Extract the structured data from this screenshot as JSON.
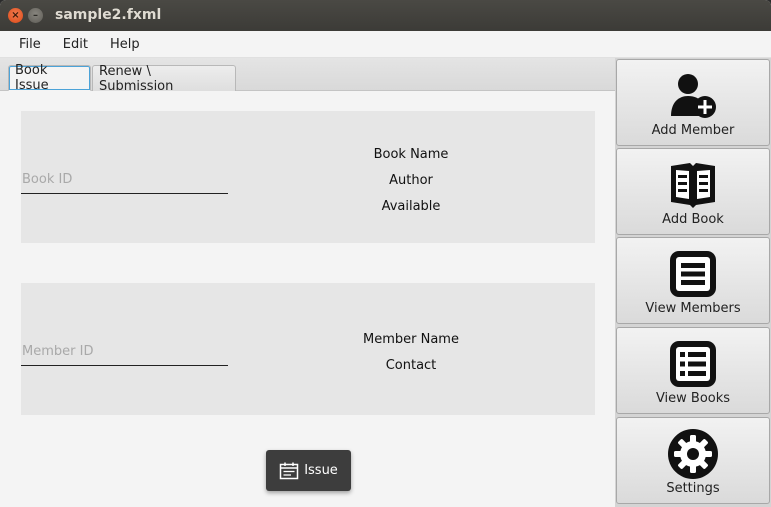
{
  "window": {
    "title": "sample2.fxml",
    "close_glyph": "×",
    "minimize_glyph": "–"
  },
  "menu": [
    "File",
    "Edit",
    "Help"
  ],
  "tabs": [
    {
      "label": "Book Issue",
      "active": true
    },
    {
      "label": "Renew \\ Submission",
      "active": false
    }
  ],
  "book_section": {
    "id_placeholder": "Book ID",
    "id_value": "",
    "info": [
      "Book Name",
      "Author",
      "Available"
    ]
  },
  "member_section": {
    "id_placeholder": "Member ID",
    "id_value": "",
    "info": [
      "Member Name",
      "Contact"
    ]
  },
  "issue_button": {
    "label": "Issue",
    "icon": "calendar-icon"
  },
  "sidebar": [
    {
      "label": "Add Member",
      "icon": "add-user-icon"
    },
    {
      "label": "Add Book",
      "icon": "open-book-icon"
    },
    {
      "label": "View Members",
      "icon": "list-icon"
    },
    {
      "label": "View Books",
      "icon": "grid-list-icon"
    },
    {
      "label": "Settings",
      "icon": "gear-icon"
    }
  ],
  "colors": {
    "titlebar": "#3c3b37",
    "close_button": "#de4a17",
    "tab_focus": "#4ca3d8",
    "issue_button_bg": "#3d3d3d"
  }
}
